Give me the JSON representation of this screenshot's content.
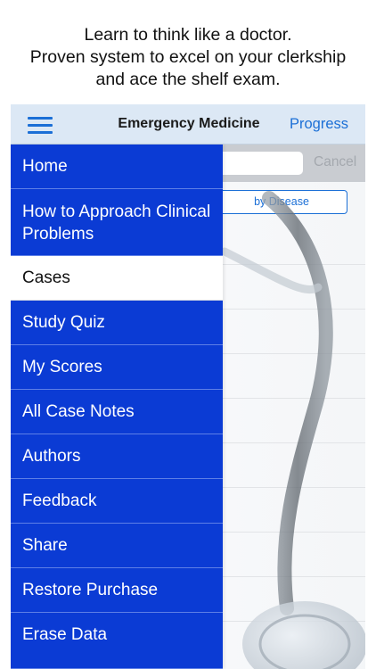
{
  "promo": {
    "line1": "Learn to think like a doctor.",
    "line2": "Proven system to excel on your clerkship",
    "line3": "and ace the shelf exam."
  },
  "navbar": {
    "menu_icon": "hamburger-menu-icon",
    "title": "Emergency Medicine",
    "progress_label": "Progress"
  },
  "search": {
    "placeholder": "",
    "cancel_label": "Cancel"
  },
  "segment": {
    "visible_label": "by Disease"
  },
  "menu": {
    "items": [
      {
        "label": "Home"
      },
      {
        "label": "How to Approach Clinical Problems"
      },
      {
        "label": "Cases"
      },
      {
        "label": "Study Quiz"
      },
      {
        "label": "My Scores"
      },
      {
        "label": "All Case Notes"
      },
      {
        "label": "Authors"
      },
      {
        "label": "Feedback"
      },
      {
        "label": "Share"
      },
      {
        "label": "Restore Purchase"
      },
      {
        "label": "Erase Data"
      }
    ],
    "selected": "Cases"
  },
  "colors": {
    "drawer": "#0b3bd4",
    "navbar": "#dce8f5",
    "accent": "#1b6fd6",
    "selected_item": "#ffffff"
  },
  "background_image": "stethoscope-illustration"
}
